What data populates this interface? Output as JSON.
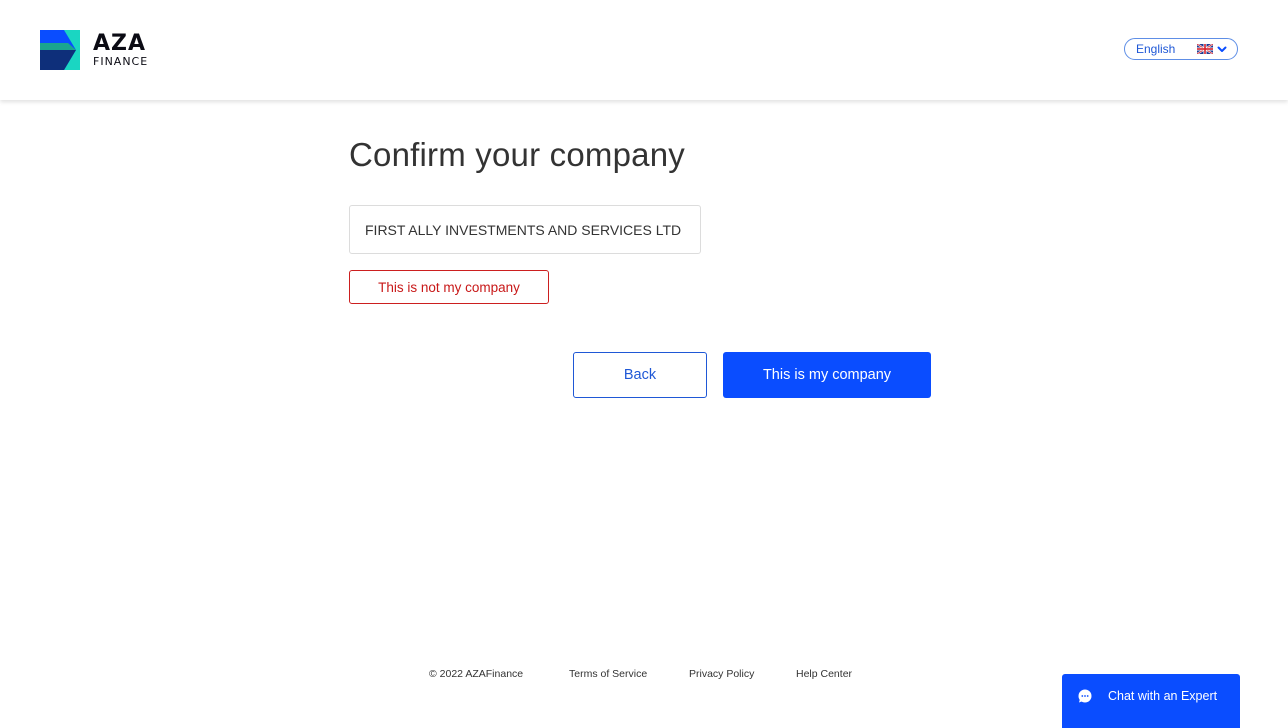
{
  "header": {
    "logo": {
      "primary": "AZA",
      "secondary": "FINANCE",
      "colors": [
        "#0a4dff",
        "#1ad6c2",
        "#0e3d8a"
      ]
    },
    "language": {
      "selected": "English",
      "flag_icon": "uk-flag-icon",
      "chevron_icon": "chevron-down-icon"
    }
  },
  "main": {
    "title": "Confirm your company",
    "company_name": "FIRST ALLY INVESTMENTS AND SERVICES LTD",
    "not_my_company_label": "This is not my company",
    "back_label": "Back",
    "confirm_label": "This is my company"
  },
  "footer": {
    "copyright": "© 2022 AZAFinance",
    "links": [
      "Terms of Service",
      "Privacy Policy",
      "Help Center"
    ]
  },
  "chat": {
    "label": "Chat with an Expert",
    "icon": "chat-bubble-icon"
  },
  "colors": {
    "accent": "#0a4dff",
    "link": "#1f58d6",
    "danger": "#c81818",
    "text": "#333333",
    "border": "#dcdcdc"
  }
}
